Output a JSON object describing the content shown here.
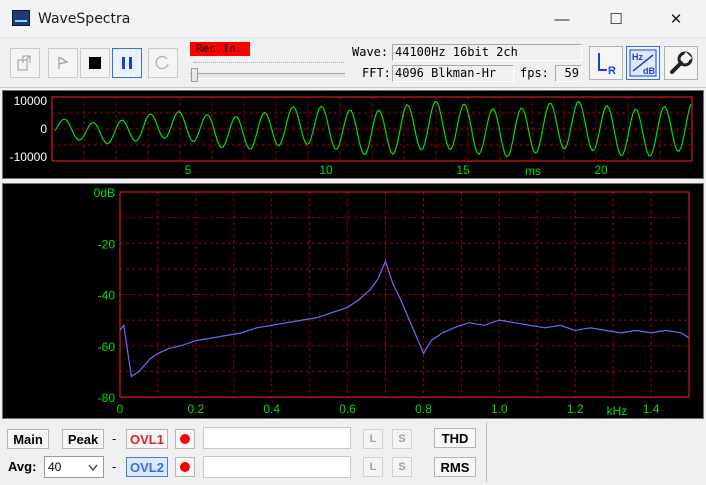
{
  "window": {
    "title": "WaveSpectra",
    "minimize": "—",
    "maximize": "☐",
    "close": "✕"
  },
  "toolbar": {
    "rec_in": "Rec.In.",
    "wave_label": "Wave:",
    "wave_value": "44100Hz 16bit 2ch",
    "fft_label": "FFT:",
    "fft_value": "4096 Blkman-Hr",
    "fps_label": "fps:",
    "fps_value": "59",
    "volume_level": 0.0
  },
  "waveform": {
    "y_ticks": [
      "10000",
      "0",
      "-10000"
    ],
    "x_ticks": [
      "5",
      "10",
      "15",
      "20"
    ],
    "x_unit": "ms",
    "colors": {
      "trace": "#00e000",
      "grid": "#c00000",
      "frame": "#ff2020",
      "labels": "#ffffff"
    }
  },
  "chart_data": {
    "type": "line",
    "title": "",
    "xlabel": "kHz",
    "ylabel": "",
    "xlim": [
      0,
      1.5
    ],
    "ylim": [
      -80,
      0
    ],
    "x_ticks": [
      "0",
      "0.2",
      "0.4",
      "0.6",
      "0.8",
      "1.0",
      "1.2",
      "1.4"
    ],
    "y_ticks": [
      "0dB",
      "-20",
      "-40",
      "-60",
      "-80"
    ],
    "grid": true,
    "series": [
      {
        "color": "#6a6aff",
        "x": [
          0.0,
          0.01,
          0.03,
          0.05,
          0.08,
          0.1,
          0.13,
          0.16,
          0.2,
          0.24,
          0.28,
          0.32,
          0.36,
          0.4,
          0.44,
          0.48,
          0.52,
          0.56,
          0.6,
          0.63,
          0.66,
          0.68,
          0.7,
          0.72,
          0.74,
          0.76,
          0.78,
          0.8,
          0.82,
          0.85,
          0.88,
          0.92,
          0.96,
          1.0,
          1.04,
          1.08,
          1.12,
          1.16,
          1.2,
          1.24,
          1.28,
          1.32,
          1.36,
          1.4,
          1.44,
          1.48,
          1.5
        ],
        "y": [
          -54,
          -52,
          -72,
          -70,
          -65,
          -63,
          -61,
          -60,
          -58,
          -57,
          -56,
          -55,
          -53,
          -52,
          -51,
          -50,
          -49,
          -47,
          -45,
          -42,
          -38,
          -34,
          -27,
          -36,
          -42,
          -49,
          -56,
          -63,
          -58,
          -55,
          -53,
          -51,
          -52,
          -50,
          -51,
          -52,
          -53,
          -52,
          -54,
          -53,
          -54,
          -55,
          -54,
          -55,
          -54,
          -55,
          -57
        ]
      }
    ],
    "colors": {
      "grid": "#c00000",
      "frame": "#ff2020",
      "labels": "#00e000"
    }
  },
  "bottom": {
    "main": "Main",
    "peak": "Peak",
    "dash": "-",
    "ovl1": "OVL1",
    "ovl2": "OVL2",
    "avg_label": "Avg:",
    "avg_value": "40",
    "l": "L",
    "s": "S",
    "thd": "THD",
    "rms": "RMS"
  }
}
